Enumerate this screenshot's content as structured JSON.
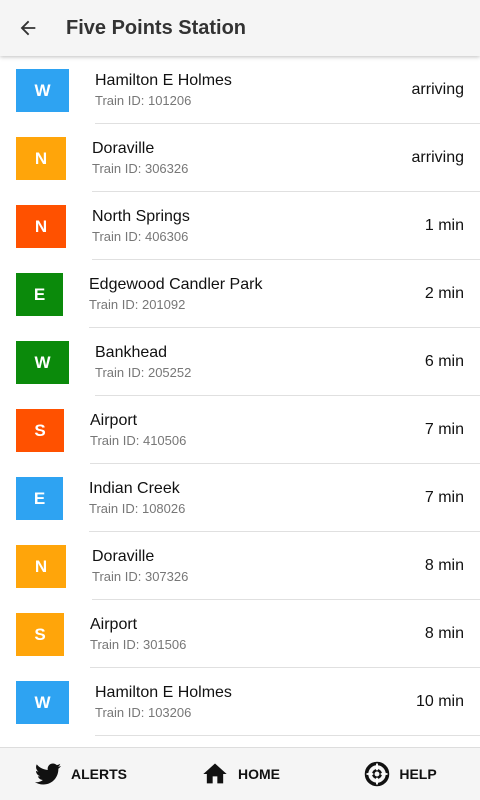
{
  "header": {
    "title": "Five Points Station",
    "back_icon": "arrow-left-icon"
  },
  "colors": {
    "blue": "#2ea3f2",
    "orange": "#ffa50a",
    "red": "#ff5100",
    "green": "#0b8a0b"
  },
  "trains": [
    {
      "line": "W",
      "color": "#2ea3f2",
      "destination": "Hamilton E Holmes",
      "train_id": "Train ID: 101206",
      "eta": "arriving"
    },
    {
      "line": "N",
      "color": "#ffa50a",
      "destination": "Doraville",
      "train_id": "Train ID: 306326",
      "eta": "arriving"
    },
    {
      "line": "N",
      "color": "#ff5100",
      "destination": "North Springs",
      "train_id": "Train ID: 406306",
      "eta": "1 min"
    },
    {
      "line": "E",
      "color": "#0b8a0b",
      "destination": "Edgewood Candler Park",
      "train_id": "Train ID: 201092",
      "eta": "2 min"
    },
    {
      "line": "W",
      "color": "#0b8a0b",
      "destination": "Bankhead",
      "train_id": "Train ID: 205252",
      "eta": "6 min"
    },
    {
      "line": "S",
      "color": "#ff5100",
      "destination": "Airport",
      "train_id": "Train ID: 410506",
      "eta": "7 min"
    },
    {
      "line": "E",
      "color": "#2ea3f2",
      "destination": "Indian Creek",
      "train_id": "Train ID: 108026",
      "eta": "7 min"
    },
    {
      "line": "N",
      "color": "#ffa50a",
      "destination": "Doraville",
      "train_id": "Train ID: 307326",
      "eta": "8 min"
    },
    {
      "line": "S",
      "color": "#ffa50a",
      "destination": "Airport",
      "train_id": "Train ID: 301506",
      "eta": "8 min"
    },
    {
      "line": "W",
      "color": "#2ea3f2",
      "destination": "Hamilton E Holmes",
      "train_id": "Train ID: 103206",
      "eta": "10 min"
    },
    {
      "line": "",
      "color": "#ff5100",
      "destination": "",
      "train_id": "",
      "eta": ""
    }
  ],
  "bottom_nav": [
    {
      "label": "ALERTS",
      "icon": "twitter-bird-icon"
    },
    {
      "label": "HOME",
      "icon": "home-icon"
    },
    {
      "label": "HELP",
      "icon": "lifebuoy-icon"
    }
  ]
}
